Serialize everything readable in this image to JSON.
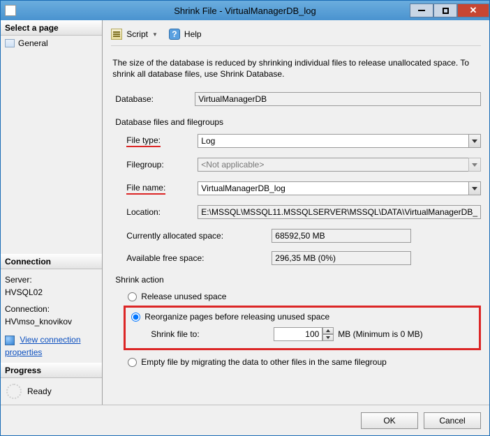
{
  "window": {
    "title": "Shrink File - VirtualManagerDB_log"
  },
  "sidebar": {
    "select_page_header": "Select a page",
    "pages": [
      "General"
    ],
    "connection_header": "Connection",
    "server_label": "Server:",
    "server_value": "HVSQL02",
    "connection_label": "Connection:",
    "connection_value": "HV\\mso_knovikov",
    "view_props": "View connection properties",
    "progress_header": "Progress",
    "progress_status": "Ready"
  },
  "toolbar": {
    "script": "Script",
    "help": "Help"
  },
  "main": {
    "description": "The size of the database is reduced by shrinking individual files to release unallocated space. To shrink all database files, use Shrink Database.",
    "database_label": "Database:",
    "database_value": "VirtualManagerDB",
    "files_groups_label": "Database files and filegroups",
    "file_type_label": "File type:",
    "file_type_value": "Log",
    "filegroup_label": "Filegroup:",
    "filegroup_value": "<Not applicable>",
    "file_name_label": "File name:",
    "file_name_value": "VirtualManagerDB_log",
    "location_label": "Location:",
    "location_value": "E:\\MSSQL\\MSSQL11.MSSQLSERVER\\MSSQL\\DATA\\VirtualManagerDB_",
    "alloc_label": "Currently allocated space:",
    "alloc_value": "68592,50 MB",
    "free_label": "Available free space:",
    "free_value": "296,35 MB (0%)",
    "shrink_action_label": "Shrink action",
    "opt_release": "Release unused space",
    "opt_reorganize": "Reorganize pages before releasing unused space",
    "shrink_to_label": "Shrink file to:",
    "shrink_to_value": "100",
    "shrink_to_unit": "MB (Minimum is 0 MB)",
    "opt_empty": "Empty file by migrating the data to other files in the same filegroup"
  },
  "footer": {
    "ok": "OK",
    "cancel": "Cancel"
  }
}
